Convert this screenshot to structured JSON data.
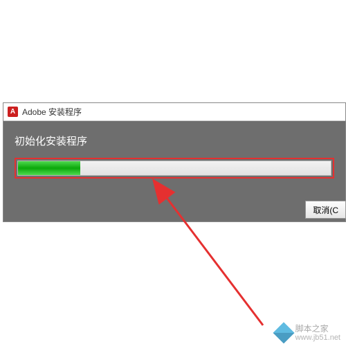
{
  "dialog": {
    "title": "Adobe 安装程序",
    "icon_letter": "A",
    "status": "初始化安装程序",
    "progress_percent": 20,
    "cancel_label": "取消(C"
  },
  "annotation": {
    "highlight_color": "#e53030"
  },
  "watermark": {
    "name": "脚本之家",
    "url": "www.jb51.net"
  }
}
